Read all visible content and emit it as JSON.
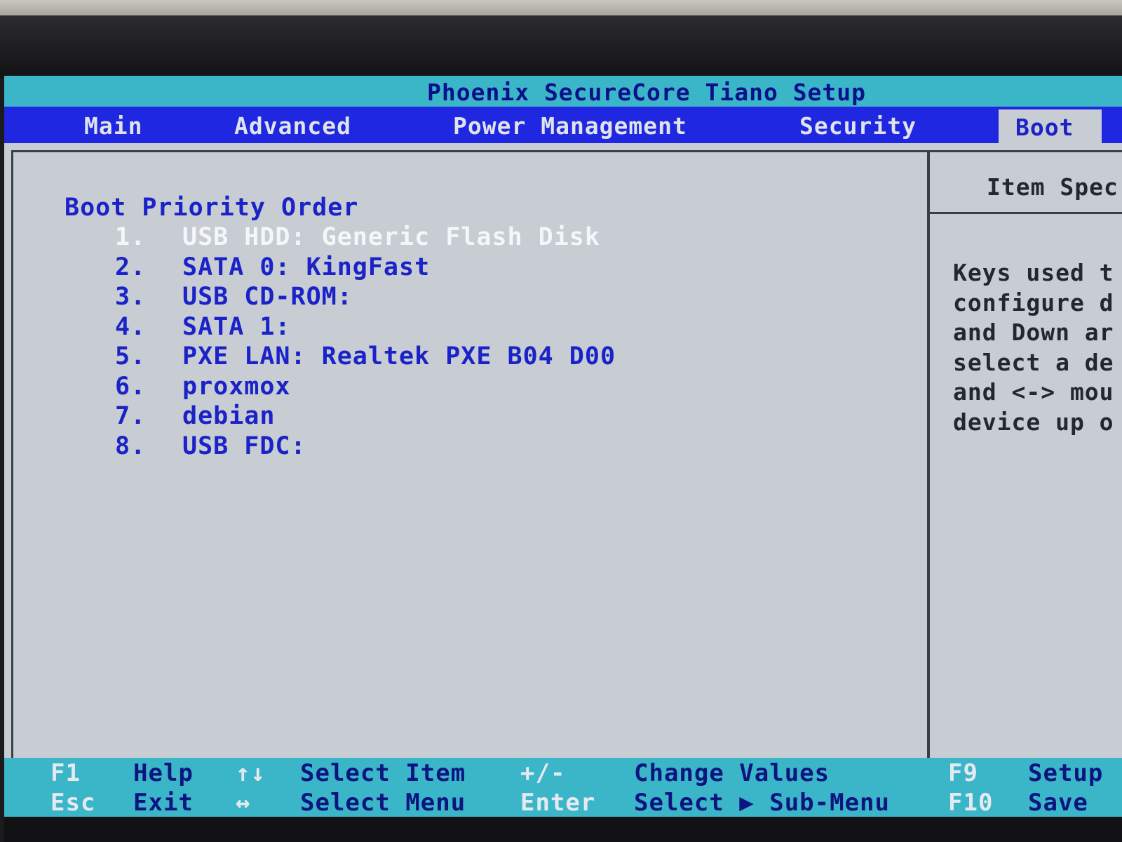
{
  "title": "Phoenix SecureCore Tiano Setup",
  "menu": [
    {
      "label": "Main",
      "active": false
    },
    {
      "label": "Advanced",
      "active": false
    },
    {
      "label": "Power Management",
      "active": false
    },
    {
      "label": "Security",
      "active": false
    },
    {
      "label": "Boot",
      "active": true
    }
  ],
  "boot": {
    "section_title": "Boot Priority Order",
    "items": [
      {
        "num": "1.",
        "label": "USB HDD: Generic Flash Disk",
        "selected": true
      },
      {
        "num": "2.",
        "label": "SATA 0: KingFast",
        "selected": false
      },
      {
        "num": "3.",
        "label": "USB CD-ROM:",
        "selected": false
      },
      {
        "num": "4.",
        "label": "SATA 1:",
        "selected": false
      },
      {
        "num": "5.",
        "label": "PXE LAN: Realtek PXE B04 D00",
        "selected": false
      },
      {
        "num": "6.",
        "label": "proxmox",
        "selected": false
      },
      {
        "num": "7.",
        "label": "debian",
        "selected": false
      },
      {
        "num": "8.",
        "label": "USB FDC:",
        "selected": false
      }
    ]
  },
  "help": {
    "title": "Item Spec",
    "lines": [
      "Keys used t",
      "configure d",
      "and Down ar",
      "select a de",
      "and <-> mou",
      "device up o"
    ]
  },
  "footer": {
    "row1": {
      "k1": "F1",
      "d1": "Help",
      "k2": "↑↓",
      "d2": "Select Item",
      "k3": "+/-",
      "d3": "Change Values",
      "k4": "F9",
      "d4": "Setup"
    },
    "row2": {
      "k1": "Esc",
      "d1": "Exit",
      "k2": "↔",
      "d2": "Select Menu",
      "k3": "Enter",
      "d3": "Select ▶ Sub-Menu",
      "k4": "F10",
      "d4": "Save"
    }
  },
  "colors": {
    "title_bg": "#3bb6c8",
    "menu_bg": "#1f27e0",
    "panel_bg": "#c7cdd3",
    "text_blue": "#1a22c8",
    "selected_text": "#f4f6fa"
  }
}
